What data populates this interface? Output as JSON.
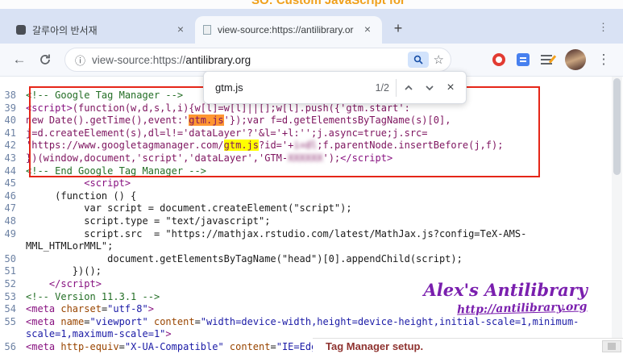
{
  "background": {
    "top_text": "SO: Custom JavaScript for",
    "bottom_text": "Tag Manager setup."
  },
  "browser": {
    "tabs": [
      {
        "title": "갈루아의 반서재",
        "active": false
      },
      {
        "title": "view-source:https://antilibrary.or",
        "active": true
      }
    ],
    "address": {
      "scheme": "view-source:https://",
      "host": "antilibrary.org"
    }
  },
  "icons": {
    "close": "×",
    "plus": "+",
    "kebab": "⋮",
    "back": "←",
    "info": "ⓘ",
    "star": "☆"
  },
  "find_bar": {
    "query": "gtm.js",
    "match_count": "1/2"
  },
  "watermark": {
    "title": "Alex's Antilibrary",
    "url": "http://antilibrary.org"
  },
  "colors": {
    "annotation_red": "#e52618",
    "highlight_active": "#ff9632",
    "highlight_other": "#ffff00",
    "watermark_purple": "#7a1fae"
  },
  "source": {
    "lines": [
      {
        "n": "38",
        "segs": [
          {
            "t": "<!-- Google Tag Manager -->",
            "c": "cm"
          }
        ]
      },
      {
        "n": "39",
        "segs": [
          {
            "t": "<script>",
            "c": "tag"
          },
          {
            "t": "(function(w,d,s,l,i){w[l]=w[l]||[];w[l].push({'gtm.start':",
            "c": "gtm"
          }
        ]
      },
      {
        "n": "40",
        "segs": [
          {
            "t": "new Date().getTime(),event:'",
            "c": "gtm"
          },
          {
            "t": "gtm.js",
            "c": "gtm",
            "h": "active"
          },
          {
            "t": "'});var f=d.getElementsByTagName(s)[0],",
            "c": "gtm"
          }
        ]
      },
      {
        "n": "41",
        "segs": [
          {
            "t": "j=d.createElement(s),dl=l!='dataLayer'?'&l='+l:'';j.async=true;j.src=",
            "c": "gtm"
          }
        ]
      },
      {
        "n": "42",
        "segs": [
          {
            "t": "'https://www.googletagmanager.com/",
            "c": "gtm"
          },
          {
            "t": "gtm.js",
            "c": "gtm",
            "h": "match"
          },
          {
            "t": "?id='+",
            "c": "gtm"
          },
          {
            "t": "i+dl",
            "c": "gtm",
            "blur": true
          },
          {
            "t": ";f.parentNode.insertBefore(j,f);",
            "c": "gtm"
          }
        ]
      },
      {
        "n": "43",
        "segs": [
          {
            "t": "})(window,document,'script','dataLayer','GTM-",
            "c": "gtm"
          },
          {
            "t": "XXXXXX",
            "c": "gtm",
            "blur": true
          },
          {
            "t": "');",
            "c": "gtm"
          },
          {
            "t": "</script>",
            "c": "tag"
          }
        ]
      },
      {
        "n": "44",
        "segs": [
          {
            "t": "<!-- End Google Tag Manager -->",
            "c": "cm"
          }
        ]
      },
      {
        "n": "45",
        "segs": [
          {
            "t": "          ",
            "c": "js"
          },
          {
            "t": "<script>",
            "c": "tag"
          }
        ]
      },
      {
        "n": "46",
        "segs": [
          {
            "t": "     (function () {",
            "c": "js"
          }
        ]
      },
      {
        "n": "47",
        "segs": [
          {
            "t": "          var script = document.createElement(\"script\");",
            "c": "js"
          }
        ]
      },
      {
        "n": "48",
        "segs": [
          {
            "t": "          script.type = \"text/javascript\";",
            "c": "js"
          }
        ]
      },
      {
        "n": "49",
        "segs": [
          {
            "t": "          script.src  = \"https://mathjax.rstudio.com/latest/MathJax.js?config=TeX-AMS-",
            "c": "js"
          }
        ]
      },
      {
        "n": "",
        "segs": [
          {
            "t": "MML_HTMLorMML\";",
            "c": "js"
          }
        ]
      },
      {
        "n": "50",
        "segs": [
          {
            "t": "              document.getElementsByTagName(\"head\")[0].appendChild(script);",
            "c": "js"
          }
        ]
      },
      {
        "n": "51",
        "segs": [
          {
            "t": "        })();",
            "c": "js"
          }
        ]
      },
      {
        "n": "52",
        "segs": [
          {
            "t": "    ",
            "c": "js"
          },
          {
            "t": "</script>",
            "c": "tag"
          }
        ]
      },
      {
        "n": "53",
        "segs": [
          {
            "t": "<!-- Version 11.3.1 -->",
            "c": "cm"
          }
        ]
      },
      {
        "n": "54",
        "segs": [
          {
            "t": "<meta ",
            "c": "tag"
          },
          {
            "t": "charset",
            "c": "attr"
          },
          {
            "t": "=",
            "c": "js"
          },
          {
            "t": "\"utf-8\"",
            "c": "val"
          },
          {
            "t": ">",
            "c": "tag"
          }
        ]
      },
      {
        "n": "55",
        "segs": [
          {
            "t": "<meta ",
            "c": "tag"
          },
          {
            "t": "name",
            "c": "attr"
          },
          {
            "t": "=",
            "c": "js"
          },
          {
            "t": "\"viewport\"",
            "c": "val"
          },
          {
            "t": " ",
            "c": "js"
          },
          {
            "t": "content",
            "c": "attr"
          },
          {
            "t": "=",
            "c": "js"
          },
          {
            "t": "\"width=device-width,height=device-height,initial-scale=1,minimum-",
            "c": "val"
          }
        ]
      },
      {
        "n": "",
        "segs": [
          {
            "t": "scale=1,maximum-scale=1\"",
            "c": "val"
          },
          {
            "t": ">",
            "c": "tag"
          }
        ]
      },
      {
        "n": "56",
        "segs": [
          {
            "t": "<meta ",
            "c": "tag"
          },
          {
            "t": "http-equiv",
            "c": "attr"
          },
          {
            "t": "=",
            "c": "js"
          },
          {
            "t": "\"X-UA-Compatible\"",
            "c": "val"
          },
          {
            "t": " ",
            "c": "js"
          },
          {
            "t": "content",
            "c": "attr"
          },
          {
            "t": "=",
            "c": "js"
          },
          {
            "t": "\"IE=Edge\"",
            "c": "val"
          },
          {
            "t": ">",
            "c": "tag"
          }
        ]
      }
    ]
  }
}
